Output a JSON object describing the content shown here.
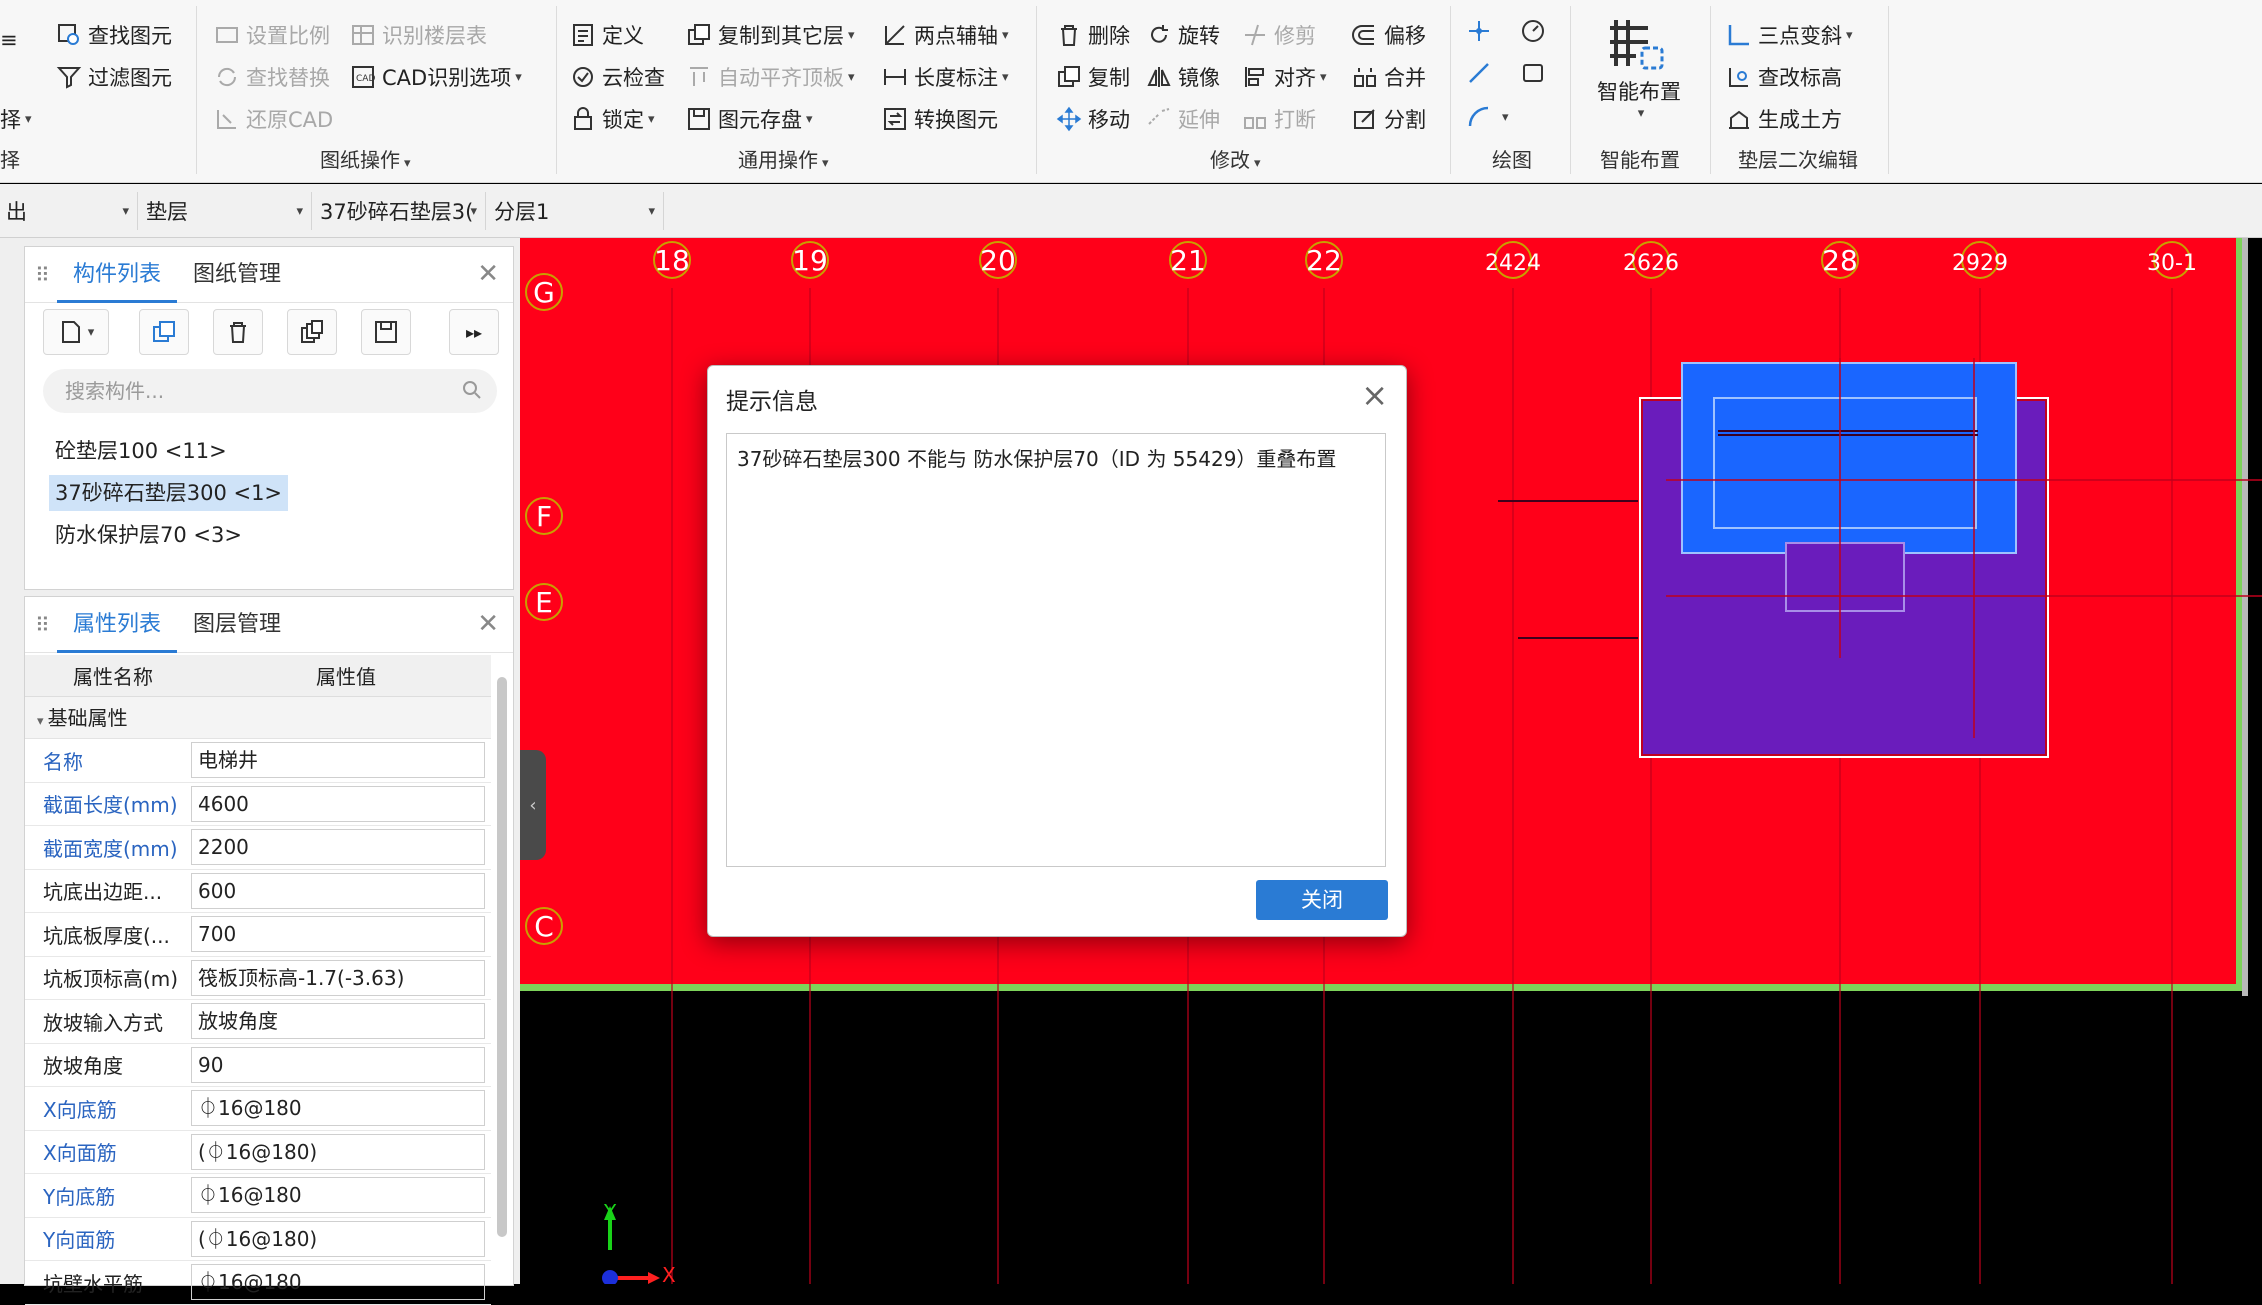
{
  "ribbon": {
    "group0": {
      "items": [
        "择",
        "择"
      ],
      "label": "择"
    },
    "group1": {
      "items": [
        "查找图元",
        "过滤图元"
      ]
    },
    "group2": {
      "items": [
        "设置比例",
        "识别楼层表",
        "查找替换",
        "CAD识别选项",
        "还原CAD"
      ],
      "label": "图纸操作"
    },
    "group3": {
      "items": [
        "定义",
        "复制到其它层",
        "两点辅轴",
        "云检查",
        "自动平齐顶板",
        "长度标注",
        "锁定",
        "图元存盘",
        "转换图元"
      ],
      "label": "通用操作"
    },
    "group4": {
      "items": [
        "删除",
        "旋转",
        "修剪",
        "偏移",
        "复制",
        "镜像",
        "对齐",
        "合并",
        "移动",
        "延伸",
        "打断",
        "分割"
      ],
      "label": "修改"
    },
    "group5": {
      "label": "绘图"
    },
    "group6": {
      "item": "智能布置",
      "label": "智能布置"
    },
    "group7": {
      "items": [
        "三点变斜",
        "查改标高",
        "生成土方"
      ],
      "label": "垫层二次编辑"
    }
  },
  "toolbar": {
    "combo0": "出",
    "combo1": "垫层",
    "combo2": "37砂碎石垫层3(",
    "combo3": "分层1"
  },
  "component_panel": {
    "tabs": [
      "构件列表",
      "图纸管理"
    ],
    "search_placeholder": "搜索构件...",
    "items": [
      "砼垫层100 <11>",
      "37砂碎石垫层300 <1>",
      "防水保护层70 <3>"
    ],
    "selected_index": 1
  },
  "property_panel": {
    "tabs": [
      "属性列表",
      "图层管理"
    ],
    "headers": [
      "属性名称",
      "属性值"
    ],
    "group": "基础属性",
    "rows": [
      {
        "name": "名称",
        "value": "电梯井"
      },
      {
        "name": "截面长度(mm)",
        "value": "4600"
      },
      {
        "name": "截面宽度(mm)",
        "value": "2200"
      },
      {
        "name": "坑底出边距...",
        "value": "600"
      },
      {
        "name": "坑底板厚度(...",
        "value": "700"
      },
      {
        "name": "坑板顶标高(m)",
        "value": "筏板顶标高-1.7(-3.63)"
      },
      {
        "name": "放坡输入方式",
        "value": "放坡角度"
      },
      {
        "name": "放坡角度",
        "value": "90"
      },
      {
        "name": "X向底筋",
        "value": "⏀16@180"
      },
      {
        "name": "X向面筋",
        "value": "(⏀16@180)"
      },
      {
        "name": "Y向底筋",
        "value": "⏀16@180"
      },
      {
        "name": "Y向面筋",
        "value": "(⏀16@180)"
      },
      {
        "name": "坑壁水平筋",
        "value": "⏀16@180"
      }
    ]
  },
  "canvas": {
    "axis_top": [
      "18",
      "19",
      "20",
      "21",
      "22",
      "2424",
      "2626",
      "28",
      "2929",
      "30-1"
    ],
    "axis_left": [
      "G",
      "F",
      "E",
      "C"
    ],
    "ucs": {
      "x": "X",
      "y": "Y"
    }
  },
  "dialog": {
    "title": "提示信息",
    "message": "37砂碎石垫层300 不能与 防水保护层70（ID 为 55429）重叠布置",
    "close_button": "关闭"
  }
}
